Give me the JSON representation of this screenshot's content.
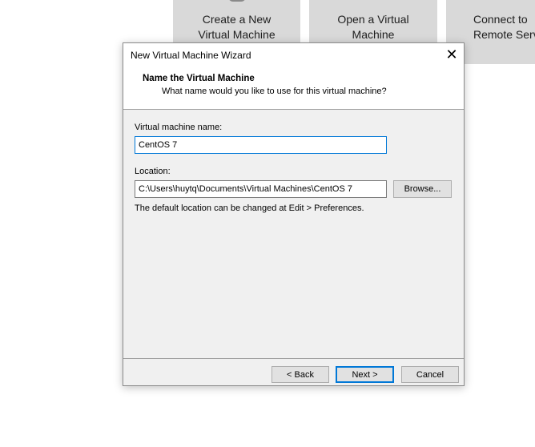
{
  "background": {
    "tiles": [
      {
        "lines": [
          "Create a New",
          "Virtual Machine"
        ]
      },
      {
        "lines": [
          "Open a Virtual",
          "Machine"
        ]
      },
      {
        "lines": [
          "Connect to",
          "Remote Serv"
        ]
      }
    ]
  },
  "dialog": {
    "title": "New Virtual Machine Wizard",
    "close_glyph": "✕",
    "header": {
      "title": "Name the Virtual Machine",
      "subtitle": "What name would you like to use for this virtual machine?"
    },
    "name_field": {
      "label": "Virtual machine name:",
      "value": "CentOS 7"
    },
    "location_field": {
      "label": "Location:",
      "value": "C:\\Users\\huytq\\Documents\\Virtual Machines\\CentOS 7"
    },
    "browse_label": "Browse...",
    "hint": "The default location can be changed at Edit > Preferences.",
    "buttons": {
      "back": "< Back",
      "next": "Next >",
      "cancel": "Cancel"
    }
  },
  "colors": {
    "accent": "#0078d7",
    "dialog_bg": "#f0f0f0",
    "tile_bg": "#d9d9d9"
  }
}
